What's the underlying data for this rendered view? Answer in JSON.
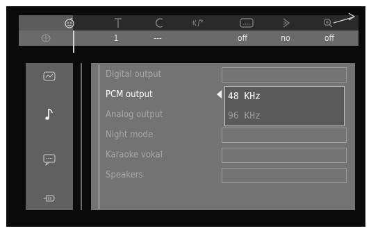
{
  "top_bar": {
    "icons": [
      "smile-face-icon",
      "title-icon",
      "chapter-icon",
      "audio-language-icon",
      "subtitle-icon",
      "angle-icon",
      "zoom-icon"
    ],
    "values": [
      "1",
      "---",
      "off",
      "no",
      "off"
    ]
  },
  "categories": [
    "disc-setup-icon",
    "video-icon",
    "audio-icon",
    "language-icon",
    "features-icon"
  ],
  "settings": {
    "rows": [
      "Digital output",
      "PCM output",
      "Analog output",
      "Night mode",
      "Karaoke vokal",
      "Speakers"
    ],
    "selected": "PCM output"
  },
  "dropdown": {
    "options": [
      "48 KHz",
      "96 KHz"
    ],
    "selected": "48 KHz"
  }
}
